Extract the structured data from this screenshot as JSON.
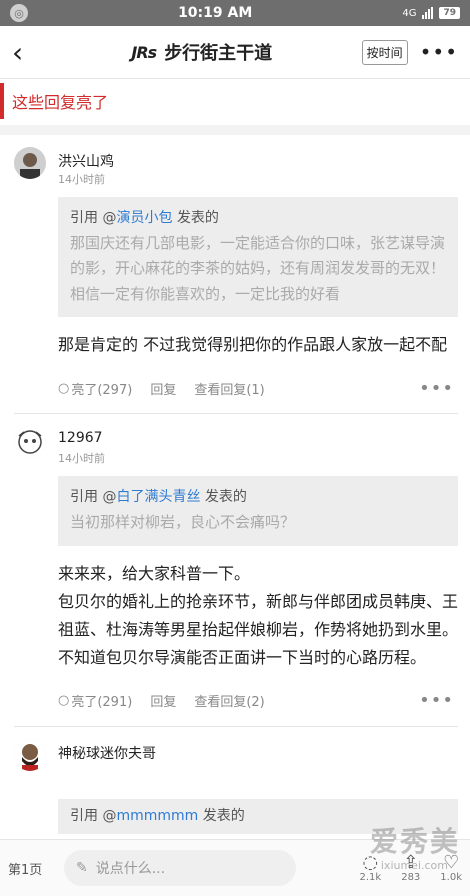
{
  "status_bar": {
    "time": "10:19 AM",
    "net": "4G",
    "battery": "79"
  },
  "nav": {
    "title": "步行街主干道",
    "logo": "JRs",
    "sort_label": "按时间",
    "more": "•••"
  },
  "section_title": "这些回复亮了",
  "posts": [
    {
      "user": "洪兴山鸡",
      "time": "14小时前",
      "quote_prefix": "引用 @",
      "quote_user": "演员小包",
      "quote_suffix": " 发表的",
      "quote_text": "那国庆还有几部电影，一定能适合你的口味，张艺谋导演的影，开心麻花的李茶的姑妈，还有周润发发哥的无双！相信一定有你能喜欢的，一定比我的好看",
      "body": "那是肯定的 不过我觉得别把你的作品跟人家放一起不配",
      "likes": "亮了(297)",
      "reply": "回复",
      "view_replies": "查看回复(1)"
    },
    {
      "user": "12967",
      "time": "14小时前",
      "quote_prefix": "引用 @",
      "quote_user": "白了满头青丝",
      "quote_suffix": " 发表的",
      "quote_text": "当初那样对柳岩，良心不会痛吗？",
      "body_lines": [
        "来来来，给大家科普一下。",
        "包贝尔的婚礼上的抢亲环节，新郎与伴郎团成员韩庚、王祖蓝、杜海涛等男星抬起伴娘柳岩，作势将她扔到水里。",
        "不知道包贝尔导演能否正面讲一下当时的心路历程。"
      ],
      "likes": "亮了(291)",
      "reply": "回复",
      "view_replies": "查看回复(2)"
    },
    {
      "user": "神秘球迷你夫哥",
      "quote_prefix": "引用 @",
      "quote_user": "mmmmmm",
      "quote_suffix": " 发表的"
    }
  ],
  "bottom": {
    "page": "第1页",
    "placeholder": "说点什么...",
    "counts": [
      "2.1k",
      "283",
      "1.0k"
    ]
  },
  "watermark": {
    "text": "爱秀美",
    "url": "ixiumei.com"
  }
}
